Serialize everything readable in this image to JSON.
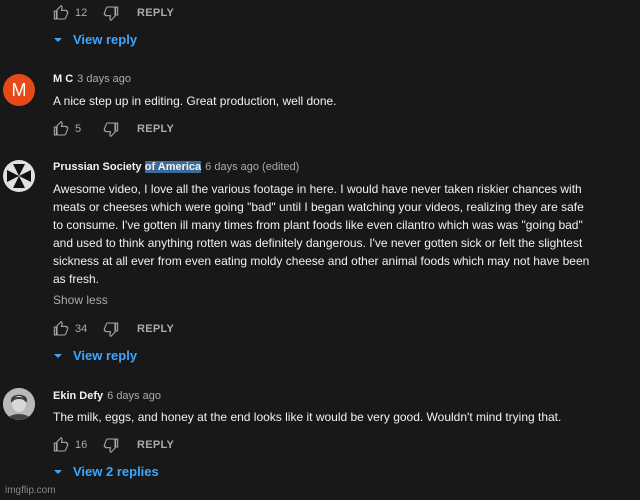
{
  "top_comment": {
    "likes": "12",
    "reply_label": "REPLY",
    "view_replies": "View reply"
  },
  "comments": [
    {
      "avatar_letter": "M",
      "avatar_color": "#e64a19",
      "author": "M C",
      "time": "3 days ago",
      "text": "A nice step up in editing. Great production, well done.",
      "likes": "5",
      "reply_label": "REPLY"
    },
    {
      "avatar_icon": "iron-cross-icon",
      "author_prefix": "Prussian Society ",
      "author_highlight": "of America",
      "time": "6 days ago (edited)",
      "text_lines": [
        "Awesome video, I love all the various footage in here. I would have never taken riskier chances with",
        "meats or cheeses which were going \"bad\" until I began watching your videos, realizing they are safe",
        "to consume. I've gotten ill many times from plant foods like even cilantro which was was \"going bad\"",
        "and used to think anything rotten was definitely dangerous. I've never gotten sick or felt the slightest",
        "sickness at all ever from even eating moldy cheese and other animal foods which may not have been",
        "as fresh."
      ],
      "show_less": "Show less",
      "likes": "34",
      "reply_label": "REPLY",
      "view_replies": "View reply"
    },
    {
      "avatar_icon": "user-photo-avatar",
      "author": "Ekin Defy",
      "time": "6 days ago",
      "text": "The milk, eggs, and honey at the end looks like it would be very good. Wouldn't mind trying that.",
      "likes": "16",
      "reply_label": "REPLY",
      "view_replies": "View 2 replies"
    }
  ],
  "watermark": "imgflip.com",
  "colors": {
    "background": "#181818",
    "link_blue": "#3ea6ff",
    "secondary_text": "#aaaaaa",
    "highlight": "#3d6a99"
  }
}
